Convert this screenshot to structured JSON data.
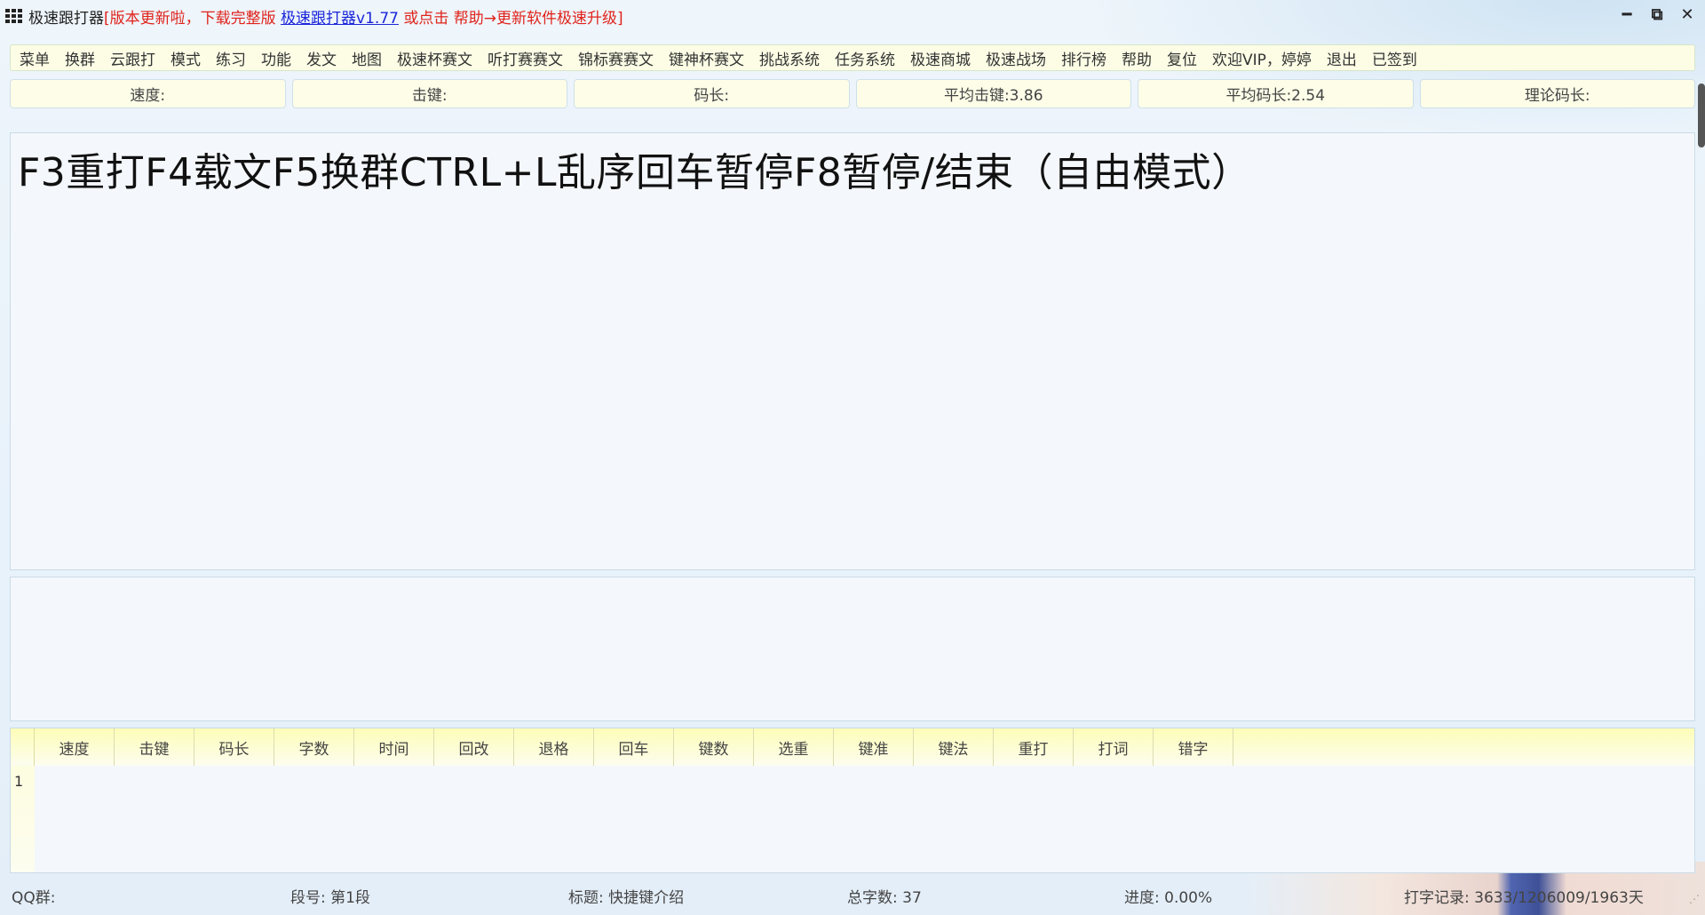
{
  "titlebar": {
    "app_name": "极速跟打器",
    "bracket_open": "[",
    "notice": "版本更新啦，下载完整版 ",
    "link_text": "极速跟打器v1.77",
    "notice2": " 或点击 帮助→更新软件极速升级",
    "bracket_close": "]"
  },
  "window_controls": {
    "minimize": "━",
    "restore": "⧉",
    "close": "✕"
  },
  "menu": {
    "items": [
      "菜单",
      "换群",
      "云跟打",
      "模式",
      "练习",
      "功能",
      "发文",
      "地图",
      "极速杯赛文",
      "听打赛赛文",
      "锦标赛赛文",
      "键神杯赛文",
      "挑战系统",
      "任务系统",
      "极速商城",
      "极速战场",
      "排行榜",
      "帮助",
      "复位",
      "欢迎VIP，婷婷",
      "退出",
      "已签到"
    ]
  },
  "stats": {
    "speed": "速度:",
    "keystroke": "击键:",
    "code_length": "码长:",
    "avg_keystroke": "平均击键:3.86",
    "avg_code_length": "平均码长:2.54",
    "theory_code_length": "理论码长:"
  },
  "text_panel": {
    "content": "F3重打F4载文F5换群CTRL+L乱序回车暂停F8暂停/结束（自由模式）"
  },
  "results": {
    "headers": [
      "速度",
      "击键",
      "码长",
      "字数",
      "时间",
      "回改",
      "退格",
      "回车",
      "键数",
      "选重",
      "键准",
      "键法",
      "重打",
      "打词",
      "错字"
    ],
    "rows": [
      "1"
    ]
  },
  "statusbar": {
    "qq_group": "QQ群:",
    "segment": "段号: 第1段",
    "title": "标题: 快捷键介绍",
    "total_chars": "总字数: 37",
    "progress": "进度: 0.00%",
    "record": "打字记录: 3633/1206009/1963天"
  }
}
